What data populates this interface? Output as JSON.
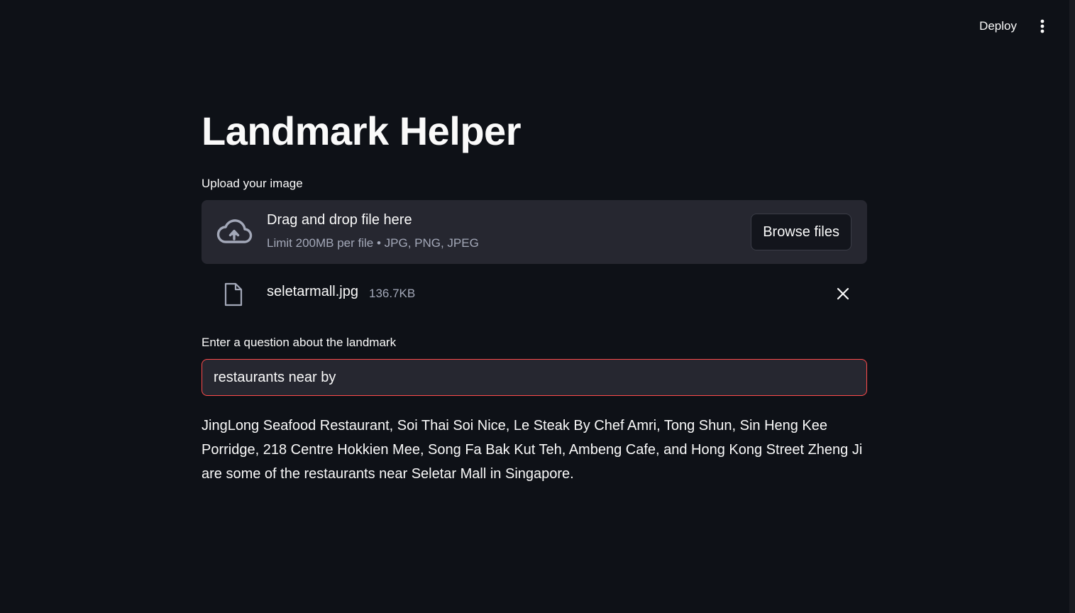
{
  "header": {
    "deploy_label": "Deploy",
    "menu_icon": "vertical-ellipsis-icon"
  },
  "page": {
    "title": "Landmark Helper"
  },
  "uploader": {
    "label": "Upload your image",
    "drop_title": "Drag and drop file here",
    "drop_subtitle": "Limit 200MB per file • JPG, PNG, JPEG",
    "browse_label": "Browse files",
    "icon": "cloud-upload-icon"
  },
  "uploaded_file": {
    "name": "seletarmall.jpg",
    "size": "136.7KB",
    "icon": "file-icon",
    "remove_icon": "close-icon"
  },
  "question": {
    "label": "Enter a question about the landmark",
    "value": "restaurants near by "
  },
  "answer": {
    "text": "JingLong Seafood Restaurant, Soi Thai Soi Nice, Le Steak By Chef Amri, Tong Shun, Sin Heng Kee Porridge, 218 Centre Hokkien Mee, Song Fa Bak Kut Teh, Ambeng Cafe, and Hong Kong Street Zheng Ji are some of the restaurants near Seletar Mall in Singapore."
  },
  "colors": {
    "background": "#0e1117",
    "surface": "#262730",
    "text": "#fafafa",
    "muted": "#a3a8b8",
    "accent": "#ff4b4b"
  }
}
